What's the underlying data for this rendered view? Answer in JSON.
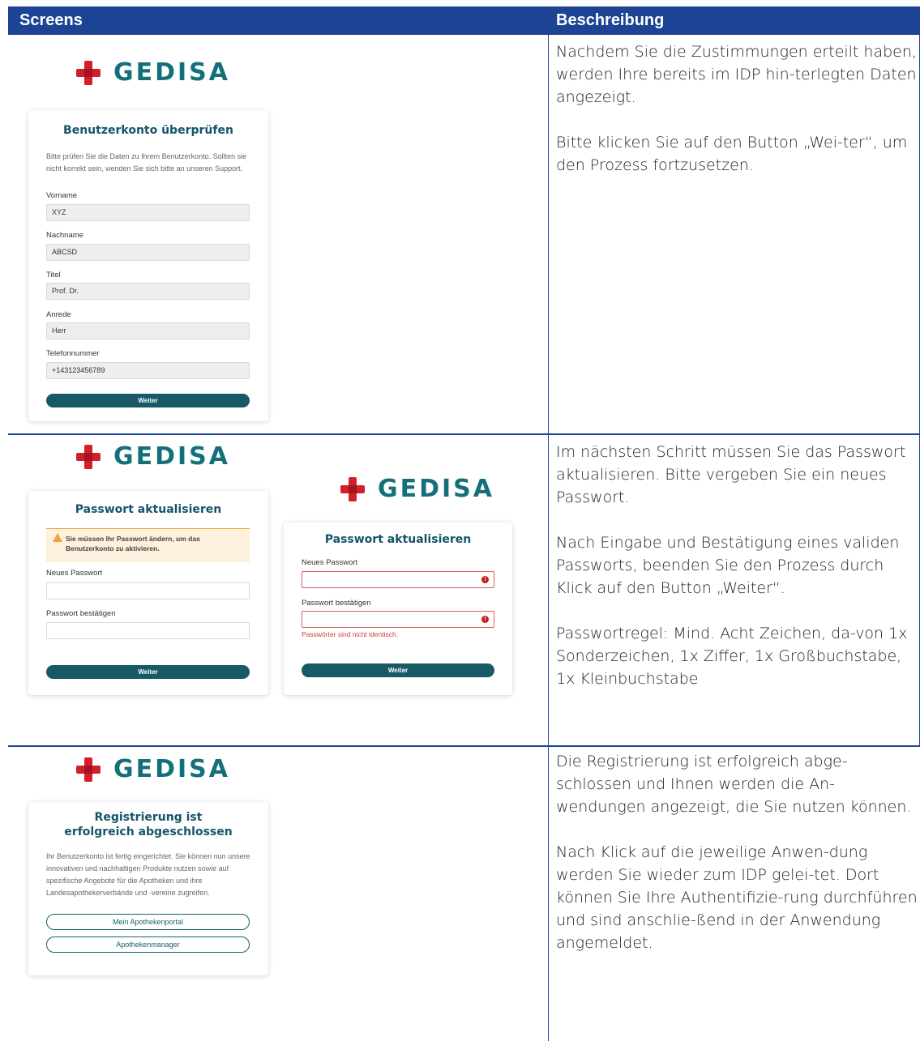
{
  "header": {
    "col1": "Screens",
    "col2": "Beschreibung"
  },
  "brand": {
    "name": "GEDISA",
    "cross_color": "#d21f2b",
    "text_color": "#13707a"
  },
  "row1": {
    "card": {
      "title": "Benutzerkonto überprüfen",
      "intro": "Bitte prüfen Sie die Daten zu Ihrem Benutzerkonto. Sollten sie nicht korrekt sein, wenden Sie sich bitte an unseren Support.",
      "fields": [
        {
          "label": "Vorname",
          "value": "XYZ"
        },
        {
          "label": "Nachname",
          "value": "ABCSD"
        },
        {
          "label": "Titel",
          "value": "Prof. Dr."
        },
        {
          "label": "Anrede",
          "value": "Herr"
        },
        {
          "label": "Telefonnummer",
          "value": "+143123456789"
        }
      ],
      "button": "Weiter"
    },
    "description": [
      "Nachdem Sie die Zustimmungen erteilt haben, werden Ihre bereits im IDP hin-terlegten Daten angezeigt.",
      "Bitte klicken Sie auf den Button „Wei-ter“, um den Prozess fortzusetzen."
    ]
  },
  "row2": {
    "card_a": {
      "title": "Passwort aktualisieren",
      "warning": "Sie müssen Ihr Passwort ändern, um das Benutzerkonto zu aktivieren.",
      "new_label": "Neues Passwort",
      "confirm_label": "Passwort bestätigen",
      "button": "Weiter"
    },
    "card_b": {
      "title": "Passwort aktualisieren",
      "new_label": "Neues Passwort",
      "confirm_label": "Passwort bestätigen",
      "error": "Passwörter sind nicht identisch.",
      "button": "Weiter"
    },
    "description": [
      "Im nächsten Schritt müssen Sie das Passwort aktualisieren. Bitte vergeben Sie ein neues Passwort.",
      "Nach Eingabe und Bestätigung eines validen Passworts, beenden Sie den Prozess durch Klick auf den Button „Weiter“.",
      "Passwortregel: Mind. Acht Zeichen, da-von 1x Sonderzeichen, 1x Ziffer, 1x Großbuchstabe, 1x Kleinbuchstabe"
    ]
  },
  "row3": {
    "card": {
      "title": "Registrierung ist erfolgreich abgeschlossen",
      "intro": "Ihr Benutzerkonto ist fertig eingerichtet. Sie können nun unsere innovativen und nachhaltigen Produkte nutzen sowie auf spezifische Angebote für die Apotheken und ihre Landesapothekerverbände und -vereine zugreifen.",
      "buttons": [
        "Mein Apothekenportal",
        "Apothekenmanager"
      ]
    },
    "description": [
      "Die Registrierung ist erfolgreich abge-schlossen und Ihnen werden die An-wendungen angezeigt, die Sie nutzen können.",
      "Nach Klick auf die jeweilige Anwen-dung werden Sie wieder zum IDP gelei-tet. Dort können Sie Ihre Authentifizie-rung durchführen und sind anschlie-ßend in der Anwendung angemeldet."
    ]
  }
}
